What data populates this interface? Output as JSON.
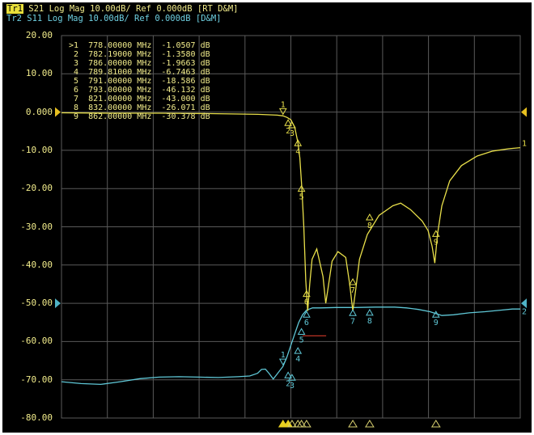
{
  "header": {
    "trace1_tag": "Tr1",
    "trace1_text": " S21 Log Mag 10.00dB/ Ref 0.000dB [RT D&M]",
    "trace2_tag": "Tr2",
    "trace2_text": " S11 Log Mag 10.00dB/ Ref 0.000dB [D&M]"
  },
  "colors": {
    "s21": "#e8df4a",
    "s11": "#5fc7d6",
    "grid": "#5a5a5a",
    "limit": "#d23a2a",
    "ref_marker_s21": "#e8c020",
    "ref_marker_s11": "#4fb3c6"
  },
  "axis": {
    "y_labels": [
      "20.00",
      "10.00",
      "0.000",
      "-10.00",
      "-20.00",
      "-30.00",
      "-40.00",
      "-50.00",
      "-60.00",
      "-70.00",
      "-80.00"
    ]
  },
  "marker_table": [
    {
      "id": ">1",
      "freq": "778.00000",
      "unit": "MHz",
      "value": "-1.0507",
      "db": "dB"
    },
    {
      "id": "2",
      "freq": "782.19000",
      "unit": "MHz",
      "value": "-1.3580",
      "db": "dB"
    },
    {
      "id": "3",
      "freq": "786.00000",
      "unit": "MHz",
      "value": "-1.9663",
      "db": "dB"
    },
    {
      "id": "4",
      "freq": "789.81000",
      "unit": "MHz",
      "value": "-6.7463",
      "db": "dB"
    },
    {
      "id": "5",
      "freq": "791.00000",
      "unit": "MHz",
      "value": "-18.586",
      "db": "dB"
    },
    {
      "id": "6",
      "freq": "793.00000",
      "unit": "MHz",
      "value": "-46.132",
      "db": "dB"
    },
    {
      "id": "7",
      "freq": "821.00000",
      "unit": "MHz",
      "value": "-43.000",
      "db": "dB"
    },
    {
      "id": "8",
      "freq": "832.00000",
      "unit": "MHz",
      "value": "-26.071",
      "db": "dB"
    },
    {
      "id": "9",
      "freq": "862.00000",
      "unit": "MHz",
      "value": "-30.378",
      "db": "dB"
    }
  ],
  "trace_end_labels": {
    "s21": "1",
    "s11": "2"
  },
  "chart_data": {
    "type": "line",
    "y_range": [
      -80,
      20
    ],
    "y_step": 10,
    "x_divisions": 10,
    "x_range_pct": [
      0,
      100
    ],
    "ref_level_db": 0,
    "series": [
      {
        "id": "S21",
        "points": [
          [
            0,
            -0.2
          ],
          [
            12,
            -0.3
          ],
          [
            25,
            -0.3
          ],
          [
            38,
            -0.4
          ],
          [
            50,
            -0.6
          ],
          [
            55,
            -0.8
          ],
          [
            56.5,
            -1.0
          ],
          [
            57.5,
            -1.4
          ],
          [
            58.5,
            -2.0
          ],
          [
            59.5,
            -4.0
          ],
          [
            60.3,
            -8.0
          ],
          [
            60.8,
            -12.0
          ],
          [
            61.3,
            -20.0
          ],
          [
            61.8,
            -30.0
          ],
          [
            62.3,
            -44.0
          ],
          [
            62.8,
            -52.0
          ],
          [
            63.3,
            -45.0
          ],
          [
            63.9,
            -38.5
          ],
          [
            65.1,
            -35.8
          ],
          [
            66.7,
            -43.0
          ],
          [
            67.4,
            -50.0
          ],
          [
            68.0,
            -46.0
          ],
          [
            69.0,
            -39.0
          ],
          [
            70.5,
            -36.5
          ],
          [
            72.5,
            -38.0
          ],
          [
            73.5,
            -45.0
          ],
          [
            74.3,
            -52.0
          ],
          [
            75.1,
            -46.0
          ],
          [
            76.0,
            -38.5
          ],
          [
            78.0,
            -32.0
          ],
          [
            81.0,
            -27.0
          ],
          [
            84.5,
            -24.5
          ],
          [
            86.5,
            -23.8
          ],
          [
            89.0,
            -25.5
          ],
          [
            92.0,
            -28.5
          ],
          [
            93.5,
            -31.0
          ],
          [
            94.5,
            -35.0
          ],
          [
            95.2,
            -39.5
          ],
          [
            95.9,
            -32.0
          ],
          [
            97.0,
            -24.5
          ],
          [
            99.0,
            -18.0
          ],
          [
            102.0,
            -14.0
          ],
          [
            106.0,
            -11.5
          ],
          [
            110.0,
            -10.2
          ],
          [
            114.0,
            -9.6
          ],
          [
            117.0,
            -9.3
          ]
        ]
      },
      {
        "id": "S11",
        "points": [
          [
            0,
            -70.5
          ],
          [
            5,
            -71.0
          ],
          [
            10,
            -71.2
          ],
          [
            15,
            -70.5
          ],
          [
            20,
            -69.7
          ],
          [
            25,
            -69.3
          ],
          [
            30,
            -69.2
          ],
          [
            35,
            -69.3
          ],
          [
            40,
            -69.4
          ],
          [
            45,
            -69.2
          ],
          [
            48,
            -69.0
          ],
          [
            50,
            -68.3
          ],
          [
            51,
            -67.3
          ],
          [
            52,
            -67.2
          ],
          [
            53,
            -68.4
          ],
          [
            54,
            -69.8
          ],
          [
            55,
            -68.5
          ],
          [
            56.5,
            -66.5
          ],
          [
            57.5,
            -64.0
          ],
          [
            58.5,
            -61.0
          ],
          [
            59.5,
            -58.0
          ],
          [
            60.5,
            -55.0
          ],
          [
            61.5,
            -53.0
          ],
          [
            62.5,
            -51.8
          ],
          [
            64,
            -51.2
          ],
          [
            66,
            -51.2
          ],
          [
            70,
            -51.1
          ],
          [
            75,
            -51.1
          ],
          [
            80,
            -51.0
          ],
          [
            85,
            -51.0
          ],
          [
            88,
            -51.2
          ],
          [
            91,
            -51.6
          ],
          [
            94,
            -52.2
          ],
          [
            97,
            -53.2
          ],
          [
            100,
            -53.0
          ],
          [
            104,
            -52.5
          ],
          [
            108,
            -52.2
          ],
          [
            112,
            -51.8
          ],
          [
            115,
            -51.5
          ],
          [
            117,
            -51.5
          ]
        ]
      }
    ],
    "markers_s21": [
      {
        "label": "1",
        "x": 56.5,
        "y": -1.0,
        "pos": "above"
      },
      {
        "label": "2",
        "x": 57.8,
        "y": -1.4,
        "pos": "below"
      },
      {
        "label": "3",
        "x": 58.8,
        "y": -2.0,
        "pos": "below"
      },
      {
        "label": "4",
        "x": 60.3,
        "y": -6.7,
        "pos": "below"
      },
      {
        "label": "5",
        "x": 61.2,
        "y": -18.6,
        "pos": "below"
      },
      {
        "label": "6",
        "x": 62.5,
        "y": -46.1,
        "pos": "below"
      },
      {
        "label": "7",
        "x": 74.3,
        "y": -43.0,
        "pos": "below"
      },
      {
        "label": "8",
        "x": 78.6,
        "y": -26.1,
        "pos": "below"
      },
      {
        "label": "9",
        "x": 95.5,
        "y": -30.4,
        "pos": "below"
      }
    ],
    "markers_s11": [
      {
        "label": "1",
        "x": 56.5,
        "y": -66.5,
        "pos": "above"
      },
      {
        "label": "2",
        "x": 57.8,
        "y": -67.4,
        "pos": "below"
      },
      {
        "label": "3",
        "x": 58.8,
        "y": -68.0,
        "pos": "below"
      },
      {
        "label": "4",
        "x": 60.3,
        "y": -61.0,
        "pos": "below"
      },
      {
        "label": "5",
        "x": 61.2,
        "y": -56.0,
        "pos": "below"
      },
      {
        "label": "6",
        "x": 62.5,
        "y": -51.5,
        "pos": "below"
      },
      {
        "label": "7",
        "x": 74.3,
        "y": -51.1,
        "pos": "below"
      },
      {
        "label": "8",
        "x": 78.6,
        "y": -51.0,
        "pos": "below"
      },
      {
        "label": "9",
        "x": 95.5,
        "y": -51.5,
        "pos": "below"
      }
    ],
    "limit_line": {
      "x_start": 61.5,
      "x_end": 67.5,
      "y": -58.5
    },
    "bottom_markers": [
      {
        "x": 56.5,
        "active": true
      },
      {
        "x": 57.8,
        "active": true
      },
      {
        "x": 58.8,
        "active": false
      },
      {
        "x": 60.3,
        "active": false
      },
      {
        "x": 61.2,
        "active": false
      },
      {
        "x": 62.5,
        "active": false
      },
      {
        "x": 74.3,
        "active": false
      },
      {
        "x": 78.6,
        "active": false
      },
      {
        "x": 95.5,
        "active": false
      }
    ]
  }
}
